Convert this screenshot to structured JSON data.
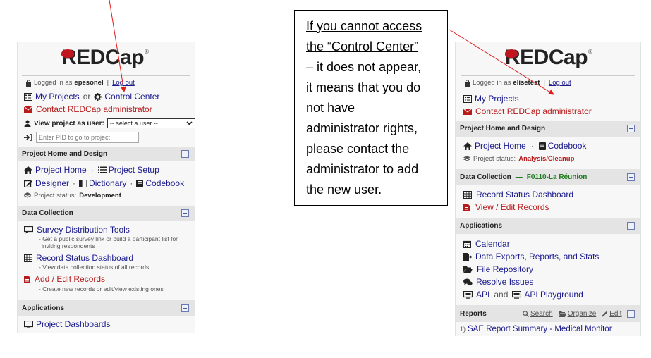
{
  "left": {
    "logo_text": "REDCap",
    "logo_mark": "®",
    "logged_in_prefix": "Logged in as",
    "username": "epesonel",
    "separator": "|",
    "logout": "Log out",
    "my_projects": "My Projects",
    "or": "or",
    "control_center": "Control Center",
    "contact_admin": "Contact REDCap administrator",
    "view_as_label": "View project as user:",
    "view_as_value": "-- select a user --",
    "pid_placeholder": "Enter PID to go to project",
    "sections": {
      "project_home_design": "Project Home and Design",
      "data_collection": "Data Collection",
      "applications": "Applications"
    },
    "project_home": "Project Home",
    "dot": "·",
    "project_setup": "Project Setup",
    "designer": "Designer",
    "dictionary": "Dictionary",
    "codebook": "Codebook",
    "status_label": "Project status:",
    "status_value": "Development",
    "survey_tools": "Survey Distribution Tools",
    "survey_tools_desc_1": "- Get a public survey link or build a participant list for",
    "survey_tools_desc_2": "inviting respondents",
    "record_status": "Record Status Dashboard",
    "record_status_desc": "- View data collection status of all records",
    "add_edit": "Add / Edit Records",
    "add_edit_desc": "- Create new records or edit/view existing ones",
    "project_dashboards": "Project Dashboards"
  },
  "note": {
    "line1": "If you cannot access",
    "line2": "the “Control Center”",
    "line3": "– it does not appear,",
    "line4": "it means that you do",
    "line5": "not have",
    "line6": "administrator rights,",
    "line7": "please contact the",
    "line8": "administrator to add",
    "line9": "the new user."
  },
  "right": {
    "logo_text": "REDCap",
    "logo_mark": "®",
    "logged_in_prefix": "Logged in as",
    "username": "elisetest",
    "separator": "|",
    "logout": "Log out",
    "my_projects": "My Projects",
    "contact_admin": "Contact REDCap administrator",
    "sections": {
      "project_home_design": "Project Home and Design",
      "data_collection": "Data Collection",
      "data_collection_dash": "—",
      "data_collection_site": "F0110-La Réunion",
      "applications": "Applications",
      "reports": "Reports"
    },
    "project_home": "Project Home",
    "dot": "·",
    "codebook": "Codebook",
    "status_label": "Project status:",
    "status_value": "Analysis/Cleanup",
    "record_status": "Record Status Dashboard",
    "view_edit": "View / Edit Records",
    "calendar": "Calendar",
    "data_exports": "Data Exports, Reports, and Stats",
    "file_repo": "File Repository",
    "resolve": "Resolve Issues",
    "api": "API",
    "and": "and",
    "api_playground": "API Playground",
    "search": "Search",
    "organize": "Organize",
    "edit": "Edit",
    "report_num": "1)",
    "report1": "SAE Report Summary - Medical Monitor"
  },
  "colors": {
    "link": "#1a1a8c",
    "red": "#b71c1c",
    "status_red": "#b71c1c",
    "site_green": "#1e7b1e",
    "arrow": "#e21b1b"
  }
}
